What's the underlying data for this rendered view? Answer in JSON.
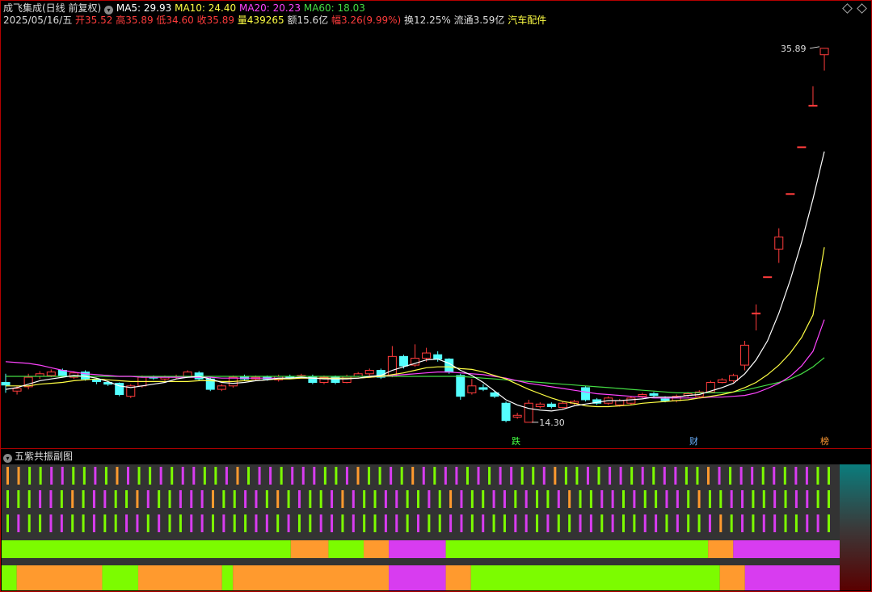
{
  "header": {
    "title": "成飞集成(日线 前复权)",
    "ma": [
      {
        "label": "MA5: 29.93",
        "color": "#ffffff"
      },
      {
        "label": "MA10: 24.40",
        "color": "#ffff44"
      },
      {
        "label": "MA20: 20.23",
        "color": "#ff44ff"
      },
      {
        "label": "MA60: 18.03",
        "color": "#44dd44"
      }
    ],
    "date": "2025/05/16/五",
    "open": "开35.52",
    "high": "高35.89",
    "low": "低34.60",
    "close": "收35.89",
    "volume": "量439265",
    "amount": "额15.6亿",
    "change": "幅3.26(9.99%)",
    "turnover": "换12.25%",
    "float": "流通3.59亿",
    "sector": "汽车配件"
  },
  "colors": {
    "up": "#ff3c3c",
    "down": "#54ffff",
    "ma5": "#ffffff",
    "ma10": "#ffff44",
    "ma20": "#ff44ff",
    "ma60": "#44dd44",
    "grid": "#b40000"
  },
  "annotations": {
    "high_label": "35.89",
    "low_label": "14.30"
  },
  "markers": [
    {
      "text": "跌",
      "color": "#44ff44"
    },
    {
      "text": "财",
      "color": "#6ab0ff"
    },
    {
      "text": "榜",
      "color": "#ff9933"
    }
  ],
  "sub_panel": {
    "title": "五紫共振副图"
  },
  "chart_data": {
    "type": "candlestick",
    "y_range": [
      13.5,
      37.0
    ],
    "candles": [
      [
        16.6,
        16.45,
        17.1,
        16.0
      ],
      [
        16.1,
        16.25,
        16.4,
        15.9
      ],
      [
        16.35,
        16.9,
        17.1,
        16.2
      ],
      [
        16.95,
        17.1,
        17.25,
        16.8
      ],
      [
        17.0,
        17.2,
        17.35,
        16.9
      ],
      [
        17.3,
        17.0,
        17.4,
        16.9
      ],
      [
        16.9,
        17.15,
        17.25,
        16.8
      ],
      [
        17.2,
        16.8,
        17.3,
        16.7
      ],
      [
        16.75,
        16.65,
        16.85,
        16.5
      ],
      [
        16.6,
        16.5,
        16.7,
        16.4
      ],
      [
        16.55,
        15.9,
        16.6,
        15.8
      ],
      [
        15.8,
        16.4,
        16.5,
        15.7
      ],
      [
        16.4,
        16.9,
        17.0,
        16.3
      ],
      [
        16.9,
        16.85,
        17.0,
        16.75
      ],
      [
        16.8,
        16.9,
        17.0,
        16.7
      ],
      [
        16.9,
        16.95,
        17.05,
        16.8
      ],
      [
        16.95,
        17.2,
        17.3,
        16.9
      ],
      [
        17.15,
        16.8,
        17.25,
        16.7
      ],
      [
        16.8,
        16.2,
        16.9,
        16.1
      ],
      [
        16.2,
        16.4,
        16.5,
        16.1
      ],
      [
        16.4,
        16.9,
        17.0,
        16.3
      ],
      [
        16.95,
        16.8,
        17.05,
        16.7
      ],
      [
        16.8,
        16.9,
        17.0,
        16.7
      ],
      [
        16.9,
        16.8,
        17.0,
        16.7
      ],
      [
        16.75,
        16.95,
        17.05,
        16.65
      ],
      [
        16.95,
        16.9,
        17.05,
        16.8
      ],
      [
        16.95,
        17.0,
        17.1,
        16.85
      ],
      [
        16.95,
        16.6,
        17.05,
        16.5
      ],
      [
        16.6,
        16.9,
        17.0,
        16.5
      ],
      [
        16.9,
        16.6,
        17.0,
        16.5
      ],
      [
        16.6,
        16.95,
        17.05,
        16.55
      ],
      [
        16.95,
        17.1,
        17.2,
        16.9
      ],
      [
        17.1,
        17.3,
        17.4,
        17.0
      ],
      [
        17.3,
        16.9,
        17.4,
        16.8
      ],
      [
        16.95,
        18.1,
        18.7,
        16.9
      ],
      [
        18.1,
        17.55,
        18.2,
        17.4
      ],
      [
        17.6,
        18.0,
        18.8,
        17.5
      ],
      [
        18.0,
        18.3,
        18.6,
        17.8
      ],
      [
        18.2,
        17.95,
        18.4,
        17.8
      ],
      [
        17.95,
        17.2,
        18.0,
        17.1
      ],
      [
        17.0,
        15.8,
        17.1,
        15.6
      ],
      [
        16.0,
        16.4,
        16.8,
        15.9
      ],
      [
        16.3,
        16.2,
        16.5,
        16.1
      ],
      [
        16.0,
        15.8,
        16.1,
        15.7
      ],
      [
        15.4,
        14.4,
        15.5,
        14.3
      ],
      [
        14.6,
        14.7,
        14.85,
        14.5
      ],
      [
        14.3,
        15.4,
        15.6,
        14.3
      ],
      [
        15.2,
        15.35,
        15.45,
        15.1
      ],
      [
        15.35,
        15.2,
        15.45,
        15.1
      ],
      [
        15.15,
        15.4,
        15.5,
        15.1
      ],
      [
        15.4,
        15.5,
        15.6,
        15.3
      ],
      [
        16.3,
        15.6,
        16.4,
        15.5
      ],
      [
        15.6,
        15.4,
        15.7,
        15.3
      ],
      [
        15.4,
        15.7,
        15.8,
        15.3
      ],
      [
        15.3,
        15.55,
        15.65,
        15.2
      ],
      [
        15.4,
        15.7,
        15.8,
        15.3
      ],
      [
        15.8,
        15.9,
        16.0,
        15.7
      ],
      [
        15.95,
        15.85,
        16.05,
        15.75
      ],
      [
        15.65,
        15.55,
        15.8,
        15.45
      ],
      [
        15.55,
        15.8,
        15.9,
        15.45
      ],
      [
        15.85,
        15.95,
        16.05,
        15.75
      ],
      [
        15.8,
        16.05,
        16.15,
        15.75
      ],
      [
        16.05,
        16.6,
        16.7,
        16.0
      ],
      [
        16.6,
        16.75,
        16.85,
        16.55
      ],
      [
        16.7,
        17.0,
        17.1,
        16.6
      ],
      [
        17.6,
        18.75,
        19.0,
        17.3
      ],
      [
        20.6,
        20.6,
        21.1,
        19.6
      ],
      [
        22.7,
        22.7,
        22.7,
        22.7
      ],
      [
        24.3,
        25.0,
        25.5,
        23.5
      ],
      [
        27.5,
        27.5,
        27.5,
        27.5
      ],
      [
        30.2,
        30.2,
        30.2,
        30.2
      ],
      [
        32.6,
        32.6,
        33.7,
        32.6
      ],
      [
        35.52,
        35.89,
        35.89,
        34.6
      ]
    ],
    "ma5": [
      16.2,
      16.3,
      16.5,
      16.7,
      16.8,
      16.9,
      17.0,
      16.95,
      16.85,
      16.65,
      16.4,
      16.3,
      16.4,
      16.5,
      16.6,
      16.8,
      16.9,
      16.95,
      16.8,
      16.6,
      16.55,
      16.6,
      16.7,
      16.75,
      16.85,
      16.85,
      16.9,
      16.85,
      16.8,
      16.8,
      16.8,
      16.85,
      16.95,
      17.0,
      17.3,
      17.5,
      17.7,
      17.9,
      17.95,
      17.7,
      17.3,
      17.0,
      16.6,
      16.1,
      15.6,
      15.3,
      15.1,
      15.0,
      14.95,
      15.05,
      15.25,
      15.35,
      15.45,
      15.55,
      15.55,
      15.6,
      15.65,
      15.75,
      15.75,
      15.75,
      15.85,
      15.9,
      16.1,
      16.3,
      16.55,
      17.1,
      17.9,
      19.0,
      20.6,
      22.5,
      24.7,
      27.2,
      29.93
    ],
    "ma10": [
      16.4,
      16.4,
      16.4,
      16.5,
      16.55,
      16.6,
      16.7,
      16.75,
      16.8,
      16.75,
      16.7,
      16.65,
      16.65,
      16.65,
      16.65,
      16.65,
      16.65,
      16.7,
      16.7,
      16.65,
      16.65,
      16.7,
      16.7,
      16.75,
      16.8,
      16.8,
      16.85,
      16.85,
      16.85,
      16.85,
      16.85,
      16.85,
      16.9,
      16.95,
      17.05,
      17.15,
      17.3,
      17.45,
      17.5,
      17.5,
      17.4,
      17.35,
      17.2,
      17.0,
      16.8,
      16.5,
      16.2,
      15.95,
      15.7,
      15.5,
      15.4,
      15.25,
      15.2,
      15.2,
      15.25,
      15.3,
      15.4,
      15.45,
      15.5,
      15.55,
      15.6,
      15.7,
      15.8,
      15.9,
      16.05,
      16.3,
      16.6,
      17.05,
      17.6,
      18.3,
      19.2,
      20.5,
      24.4
    ],
    "ma20": [
      17.8,
      17.75,
      17.7,
      17.6,
      17.45,
      17.3,
      17.2,
      17.1,
      17.05,
      17.0,
      16.95,
      16.95,
      16.9,
      16.9,
      16.9,
      16.9,
      16.9,
      16.9,
      16.9,
      16.85,
      16.85,
      16.85,
      16.85,
      16.85,
      16.85,
      16.85,
      16.85,
      16.85,
      16.85,
      16.85,
      16.85,
      16.85,
      16.9,
      16.95,
      17.0,
      17.05,
      17.1,
      17.15,
      17.2,
      17.2,
      17.15,
      17.1,
      17.05,
      16.95,
      16.85,
      16.7,
      16.55,
      16.45,
      16.35,
      16.25,
      16.15,
      16.05,
      15.95,
      15.9,
      15.85,
      15.8,
      15.75,
      15.7,
      15.7,
      15.7,
      15.7,
      15.7,
      15.75,
      15.75,
      15.8,
      15.85,
      16.0,
      16.25,
      16.55,
      16.95,
      17.55,
      18.4,
      20.23
    ],
    "ma60": [
      16.95,
      16.95,
      16.95,
      16.95,
      16.95,
      16.95,
      16.95,
      16.95,
      16.95,
      16.95,
      16.95,
      16.95,
      16.95,
      16.95,
      16.95,
      16.95,
      16.95,
      16.95,
      16.95,
      16.95,
      16.95,
      16.95,
      16.95,
      16.95,
      16.95,
      16.95,
      16.95,
      16.95,
      16.95,
      16.95,
      16.95,
      16.95,
      16.95,
      16.95,
      16.95,
      16.95,
      16.95,
      16.95,
      16.95,
      16.95,
      16.95,
      16.9,
      16.85,
      16.8,
      16.75,
      16.7,
      16.65,
      16.6,
      16.55,
      16.5,
      16.45,
      16.4,
      16.35,
      16.3,
      16.25,
      16.2,
      16.15,
      16.1,
      16.05,
      16.0,
      16.0,
      16.0,
      16.0,
      16.0,
      16.05,
      16.15,
      16.3,
      16.45,
      16.6,
      16.8,
      17.1,
      17.5,
      18.03
    ],
    "resonance_rows": [
      "OOGGPPGGPGOPGGPGPPGGPOGPPGPPPGGPOGGPGOPGPPGPGPPGGPOGGPGPPGPGPPGGOPGPPGPGPPGG",
      "GGGPPGOGPPGGOPGGPPPOGGPPGOGPGGPOPGGPPGGPGOPGGPPGPGGPOGGPPGPGGPPGOGGPPGGPGPPGG",
      "GPGGPPGGPGGPPGPGGPPGPGGPPGPGGPPGPGGPPGPGGPPGPGGPPGPGGPPGPGGPPGPGGPOGPGPPGGPPG"
    ],
    "band1": [
      [
        "G",
        0,
        0.345
      ],
      [
        "O",
        0.345,
        0.39
      ],
      [
        "G",
        0.39,
        0.432
      ],
      [
        "O",
        0.432,
        0.462
      ],
      [
        "P",
        0.462,
        0.53
      ],
      [
        "G",
        0.53,
        0.843
      ],
      [
        "O",
        0.843,
        0.873
      ],
      [
        "P",
        0.873,
        1.0
      ]
    ],
    "band2": [
      [
        "G",
        0,
        0.018
      ],
      [
        "O",
        0.018,
        0.12
      ],
      [
        "G",
        0.12,
        0.163
      ],
      [
        "O",
        0.163,
        0.263
      ],
      [
        "G",
        0.263,
        0.276
      ],
      [
        "O",
        0.276,
        0.462
      ],
      [
        "P",
        0.462,
        0.53
      ],
      [
        "O",
        0.53,
        0.56
      ],
      [
        "G",
        0.56,
        0.857
      ],
      [
        "O",
        0.857,
        0.887
      ],
      [
        "P",
        0.887,
        1.0
      ]
    ],
    "band_colors": {
      "G": "#7cfc00",
      "O": "#ff9a2e",
      "P": "#d83cf0"
    }
  }
}
